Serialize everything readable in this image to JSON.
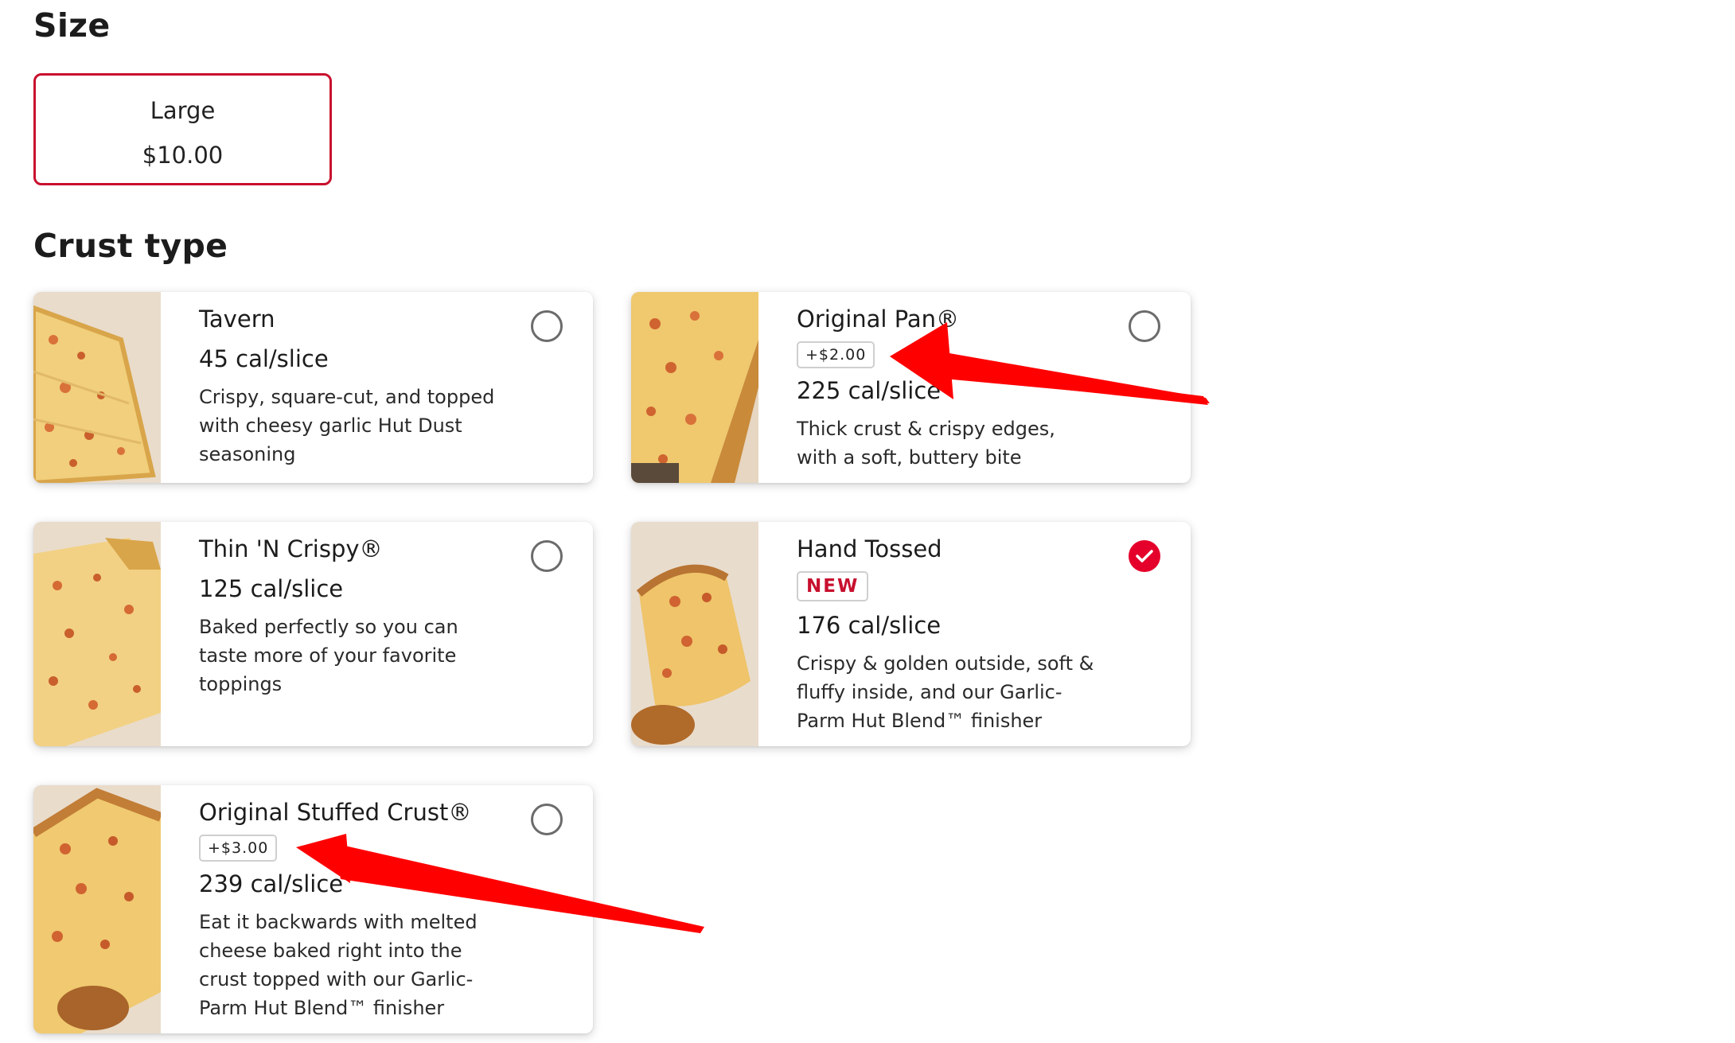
{
  "size": {
    "title": "Size",
    "selected": {
      "name": "Large",
      "price": "$10.00"
    }
  },
  "crust": {
    "title": "Crust type",
    "options": [
      {
        "name": "Tavern",
        "calories": "45 cal/slice",
        "description": "Crispy, square-cut, and topped with cheesy garlic Hut Dust seasoning",
        "selected": false
      },
      {
        "name": "Original Pan®",
        "price_badge": "+$2.00",
        "calories": "225 cal/slice",
        "description": "Thick crust & crispy edges, with a soft, buttery bite",
        "selected": false
      },
      {
        "name": "Thin 'N Crispy®",
        "calories": "125 cal/slice",
        "description": "Baked perfectly so you can taste more of your favorite toppings",
        "selected": false
      },
      {
        "name": "Hand Tossed",
        "new_badge": "NEW",
        "calories": "176 cal/slice",
        "description": "Crispy & golden outside, soft & fluffy inside, and our Garlic-Parm Hut Blend™ finisher",
        "selected": true
      },
      {
        "name": "Original Stuffed Crust®",
        "price_badge": "+$3.00",
        "calories": "239 cal/slice",
        "description": "Eat it backwards with melted cheese baked right into the crust topped with our Garlic-Parm Hut Blend™ finisher",
        "selected": false
      }
    ]
  },
  "icons": {
    "radio_unselected": "radio-empty-icon",
    "radio_selected": "check-circle-icon",
    "annotation": "arrow-icon"
  },
  "colors": {
    "accent_red": "#c8102e",
    "check_red": "#e4002b",
    "arrow_red": "#ff0000",
    "badge_border": "#cfcfcf"
  }
}
